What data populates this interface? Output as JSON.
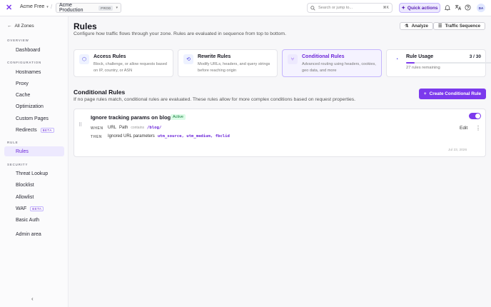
{
  "topbar": {
    "logo_icon": "x-logo-icon",
    "account": "Acme Free",
    "zone": "Acme Production",
    "zone_badge": "PROD",
    "search_placeholder": "Search or jump to...",
    "search_shortcut": "⌘K",
    "quick_actions": "Quick actions",
    "avatar_initials": "DA"
  },
  "sidebar": {
    "back": "All Zones",
    "sections": {
      "overview": "OVERVIEW",
      "configuration": "CONFIGURATION",
      "rule": "RULE",
      "security": "SECURITY"
    },
    "items": {
      "dashboard": "Dashboard",
      "hostnames": "Hostnames",
      "proxy": "Proxy",
      "cache": "Cache",
      "optimization": "Optimization",
      "custom_pages": "Custom Pages",
      "redirects": "Redirects",
      "redirects_badge": "BETA",
      "rules": "Rules",
      "threat_lookup": "Threat Lookup",
      "blocklist": "Blocklist",
      "allowlist": "Allowlist",
      "waf": "WAF",
      "waf_badge": "BETA",
      "basic_auth": "Basic Auth",
      "admin_area": "Admin area"
    }
  },
  "page": {
    "title": "Rules",
    "subtitle": "Configure how traffic flows through your zone. Rules are evaluated in sequence from top to bottom.",
    "analyze": "Analyze",
    "traffic_sequence": "Traffic Sequence"
  },
  "cards": {
    "access": {
      "title": "Access Rules",
      "desc": "Block, challenge, or allow requests based on IP, country, or ASN"
    },
    "rewrite": {
      "title": "Rewrite Rules",
      "desc": "Modify URLs, headers, and query strings before reaching origin"
    },
    "conditional": {
      "title": "Conditional Rules",
      "desc": "Advanced routing using headers, cookies, geo data, and more"
    },
    "usage": {
      "title": "Rule Usage",
      "count": "3 / 30",
      "remaining": "27 rules remaining",
      "fraction": 0.1
    }
  },
  "section": {
    "title": "Conditional Rules",
    "subtitle": "If no page rules match, conditional rules are evaluated. These rules allow for more complex conditions based on request properties.",
    "create": "Create Conditional Rule"
  },
  "rule": {
    "name": "Ignore tracking params on blog",
    "status": "Active",
    "when_kw": "WHEN",
    "when_field": "URL",
    "when_sub": "Path",
    "when_op": "contains",
    "when_value": "/blog/",
    "then_kw": "THEN",
    "then_action": "Ignored URL parameters",
    "then_values": "utm_source, utm_medium, fbclid",
    "edit": "Edit",
    "date": "Jul 23, 2026"
  },
  "colors": {
    "accent": "#7c3aed",
    "accent_soft": "#ede9fe",
    "active_green": "#15803d"
  }
}
